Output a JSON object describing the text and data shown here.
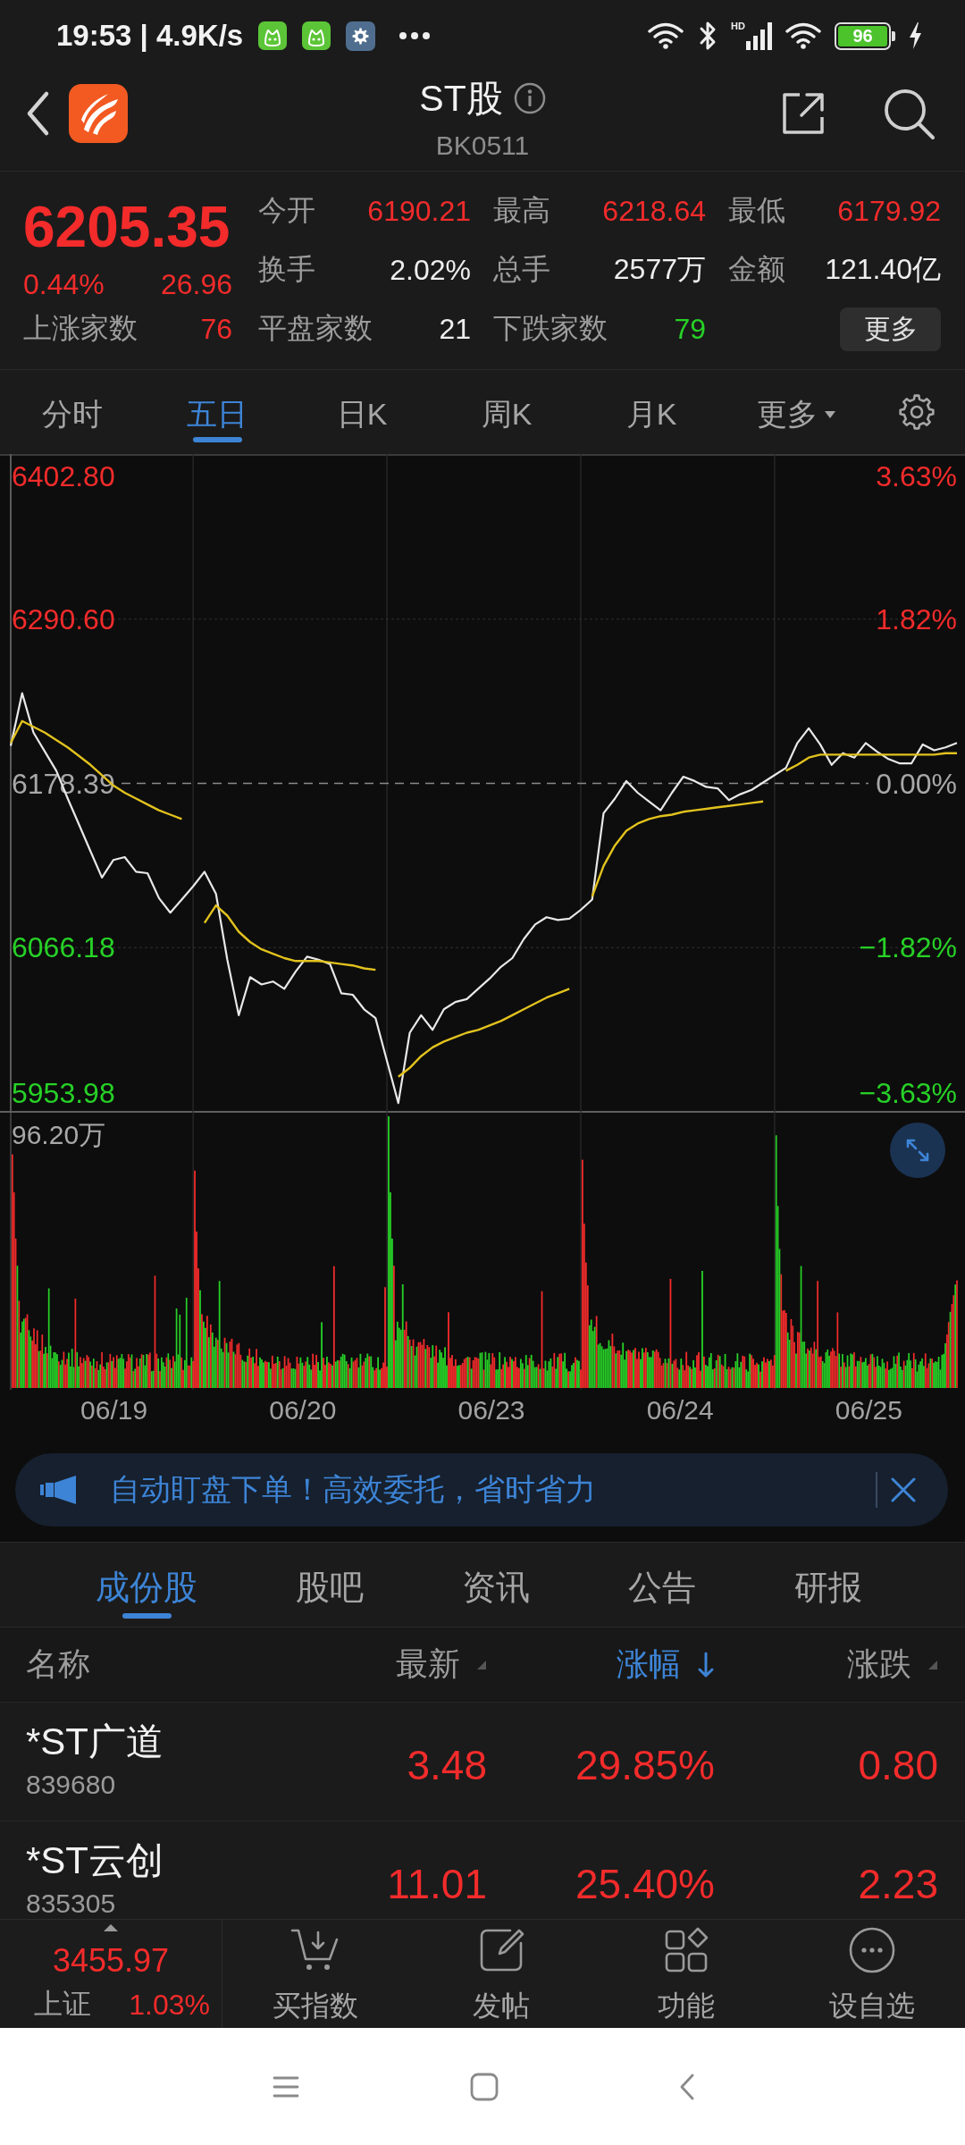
{
  "status_bar": {
    "time_and_speed": "19:53 | 4.9K/s",
    "network_type": "HD",
    "battery": "96"
  },
  "header": {
    "title": "ST股",
    "code": "BK0511"
  },
  "quote": {
    "price": "6205.35",
    "change_percent": "0.44%",
    "change": "26.96",
    "color": "#f32b2b",
    "advancers": {
      "label": "上涨家数",
      "value": "76",
      "color": "#f32b2b"
    }
  },
  "stats": [
    {
      "label": "今开",
      "value": "6190.21",
      "color": "#f32b2b"
    },
    {
      "label": "最高",
      "value": "6218.64",
      "color": "#f32b2b"
    },
    {
      "label": "最低",
      "value": "6179.92",
      "color": "#f32b2b"
    },
    {
      "label": "换手",
      "value": "2.02%",
      "color": "#eeeeee"
    },
    {
      "label": "总手",
      "value": "2577万",
      "color": "#eeeeee"
    },
    {
      "label": "金额",
      "value": "121.40亿",
      "color": "#eeeeee"
    },
    {
      "label": "平盘家数",
      "value": "21",
      "color": "#eeeeee"
    },
    {
      "label": "下跌家数",
      "value": "79",
      "color": "#27d127"
    }
  ],
  "more_button": "更多",
  "chart_tabs": [
    {
      "label": "分时",
      "kind": "tab",
      "selected": false
    },
    {
      "label": "五日",
      "kind": "tab",
      "selected": true
    },
    {
      "label": "日K",
      "kind": "tab",
      "selected": false
    },
    {
      "label": "周K",
      "kind": "tab",
      "selected": false
    },
    {
      "label": "月K",
      "kind": "tab",
      "selected": false
    },
    {
      "label": "更多",
      "kind": "menu",
      "selected": false
    }
  ],
  "price_chart": {
    "right_labels": [
      "3.63%",
      "1.82%",
      "0.00%",
      "−1.82%",
      "−3.63%"
    ],
    "chart_data": {
      "type": "line",
      "categories": [
        null,
        null,
        null,
        null,
        null,
        null,
        null,
        null,
        null,
        null,
        null,
        null,
        null,
        null,
        null,
        null,
        null,
        null,
        null,
        null,
        null,
        null,
        null,
        null,
        null,
        null,
        null,
        null,
        null,
        null,
        null,
        null,
        null,
        null,
        null,
        null,
        null,
        null,
        null,
        null,
        null,
        null,
        null,
        null,
        null,
        null,
        null,
        null,
        null,
        null,
        null,
        null,
        null,
        null,
        null,
        null,
        null,
        null,
        null,
        null,
        null,
        null,
        null,
        null,
        null,
        null,
        null,
        null,
        null,
        null,
        null,
        null,
        null,
        null,
        null,
        null,
        null,
        null,
        null,
        null,
        null,
        null,
        null,
        null
      ],
      "series": [
        {
          "color": "#e8e8e8",
          "values": [
            6204,
            6240,
            6213,
            6200,
            6187,
            6168,
            6150,
            6132,
            6114,
            6126,
            6128,
            6118,
            6117,
            6100,
            6090,
            6099,
            6108,
            6118,
            6103,
            6058,
            6020,
            6046,
            6041,
            6043,
            6038,
            6050,
            6060,
            6058,
            6055,
            6035,
            6034,
            6024,
            6018,
            5989,
            5960,
            6008,
            6020,
            6010,
            6024,
            6029,
            6031,
            6038,
            6045,
            6053,
            6059,
            6072,
            6082,
            6087,
            6085,
            6086,
            6092,
            6099,
            6158,
            6168,
            6180,
            6172,
            6166,
            6160,
            6172,
            6183,
            6180,
            6176,
            6175,
            6167,
            6171,
            6174,
            6179,
            6184,
            6189,
            6206,
            6216,
            6205,
            6191,
            6199,
            6196,
            6206,
            6200,
            6195,
            6192,
            6192,
            6205,
            6201,
            6203,
            6206
          ]
        },
        {
          "color": "#e2c21e",
          "values": [
            6206,
            6221,
            6217,
            6213,
            6208,
            6203,
            6197,
            6191,
            6184,
            6177,
            6172,
            6168,
            6164,
            6160,
            6157,
            6154,
            null,
            6083,
            6095,
            6088,
            6077,
            6070,
            6065,
            6062,
            6059,
            6057,
            6057,
            6057,
            6056,
            6055,
            6054,
            6052,
            6051,
            null,
            5978,
            5984,
            5992,
            5998,
            6002,
            6005,
            6008,
            6010,
            6013,
            6016,
            6020,
            6024,
            6028,
            6032,
            6035,
            6038,
            null,
            6101,
            6122,
            6136,
            6146,
            6151,
            6154,
            6156,
            6157,
            6159,
            6160,
            6161,
            6162,
            6163,
            6164,
            6165,
            6166,
            null,
            6187,
            6191,
            6196,
            6198,
            6198,
            6198,
            6198,
            6198,
            6198,
            6198,
            6198,
            6198,
            6198,
            6198,
            6199,
            6199
          ]
        }
      ],
      "ylim": [
        5953.98,
        6402.8
      ],
      "yticks": [
        {
          "value": 6402.8,
          "label": "6402.80"
        },
        {
          "value": 6290.6,
          "label": "6290.60"
        },
        {
          "value": 6178.39,
          "label": "6178.39"
        },
        {
          "value": 6066.18,
          "label": "6066.18"
        },
        {
          "value": 5953.98,
          "label": "5953.98"
        }
      ],
      "grid": true
    }
  },
  "volume_chart": {
    "max_label": "96.20万",
    "dates": [
      "06/19",
      "06/20",
      "06/23",
      "06/24",
      "06/25"
    ]
  },
  "banner": {
    "text": "自动盯盘下单！高效委托，省时省力"
  },
  "section_tabs": [
    {
      "label": "成份股",
      "selected": true
    },
    {
      "label": "股吧",
      "selected": false
    },
    {
      "label": "资讯",
      "selected": false
    },
    {
      "label": "公告",
      "selected": false
    },
    {
      "label": "研报",
      "selected": false
    }
  ],
  "table": {
    "columns": [
      {
        "label": "名称",
        "sort_hint": false,
        "selected": false
      },
      {
        "label": "最新",
        "sort_hint": true,
        "selected": false
      },
      {
        "label": "涨幅",
        "sort_hint": false,
        "selected": true
      },
      {
        "label": "涨跌",
        "sort_hint": true,
        "selected": false
      }
    ],
    "rows": [
      {
        "name": "*ST广道",
        "code": "839680",
        "price": "3.48",
        "change_percent": "29.85%",
        "change": "0.80",
        "color": "#f32b2b"
      },
      {
        "name": "*ST云创",
        "code": "835305",
        "price": "11.01",
        "change_percent": "25.40%",
        "change": "2.23",
        "color": "#f32b2b"
      }
    ]
  },
  "bottom_bar": {
    "index_value": "3455.97",
    "index_name": "上证",
    "index_change": "1.03%",
    "color": "#f32b2b",
    "actions": [
      "买指数",
      "发帖",
      "功能",
      "设自选"
    ]
  }
}
